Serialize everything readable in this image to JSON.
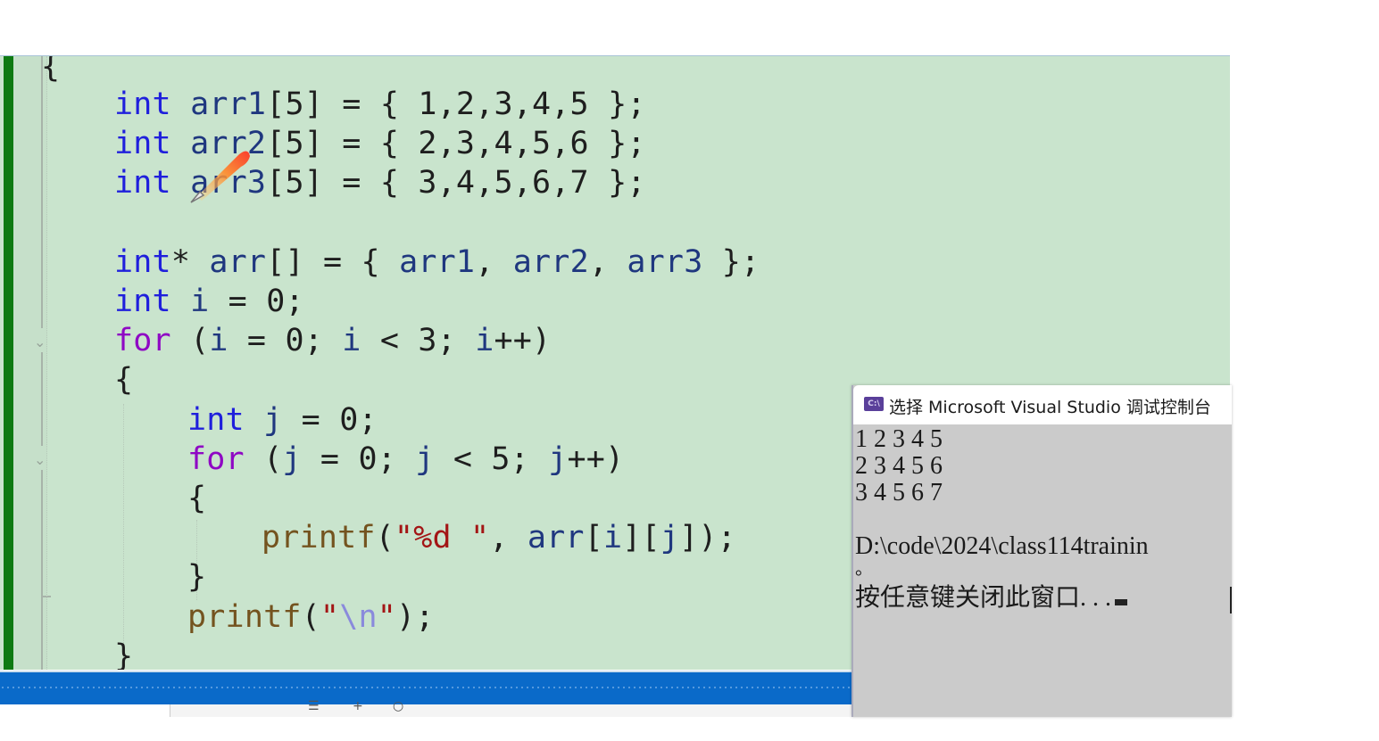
{
  "editor": {
    "background": "#c9e4cd",
    "lines": [
      {
        "text": "{"
      },
      {
        "parts": [
          [
            "kw",
            "int"
          ],
          [
            "",
            "  "
          ],
          [
            "var",
            "arr1"
          ],
          [
            "",
            "[5] = { 1,2,3,4,5 };"
          ]
        ]
      },
      {
        "parts": [
          [
            "kw",
            "int"
          ],
          [
            "",
            "  "
          ],
          [
            "var",
            "arr2"
          ],
          [
            "",
            "[5] = { 2,3,4,5,6 };"
          ]
        ]
      },
      {
        "parts": [
          [
            "kw",
            "int"
          ],
          [
            "",
            "  "
          ],
          [
            "var",
            "arr3"
          ],
          [
            "",
            "[5] = { 3,4,5,6,7 };"
          ]
        ]
      },
      {
        "parts": [
          [
            "kw",
            "int"
          ],
          [
            "",
            "* "
          ],
          [
            "var",
            "arr"
          ],
          [
            "",
            "[] = { "
          ],
          [
            "var",
            "arr1"
          ],
          [
            "",
            ", "
          ],
          [
            "var",
            "arr2"
          ],
          [
            "",
            ", "
          ],
          [
            "var",
            "arr3"
          ],
          [
            "",
            " };"
          ]
        ]
      },
      {
        "parts": [
          [
            "kw",
            "int"
          ],
          [
            "",
            " "
          ],
          [
            "var",
            "i"
          ],
          [
            "",
            " = 0;"
          ]
        ]
      },
      {
        "parts": [
          [
            "ctl",
            "for"
          ],
          [
            "",
            " ("
          ],
          [
            "var",
            "i"
          ],
          [
            "",
            " = 0; "
          ],
          [
            "var",
            "i"
          ],
          [
            "",
            " < 3; "
          ],
          [
            "var",
            "i"
          ],
          [
            "",
            "++)"
          ]
        ]
      },
      {
        "text": "{"
      },
      {
        "parts": [
          [
            "kw",
            "int"
          ],
          [
            "",
            " "
          ],
          [
            "var",
            "j"
          ],
          [
            "",
            " = 0;"
          ]
        ]
      },
      {
        "parts": [
          [
            "ctl",
            "for"
          ],
          [
            "",
            " ("
          ],
          [
            "var",
            "j"
          ],
          [
            "",
            " = 0; "
          ],
          [
            "var",
            "j"
          ],
          [
            "",
            " < 5; "
          ],
          [
            "var",
            "j"
          ],
          [
            "",
            "++)"
          ]
        ]
      },
      {
        "text": "{"
      },
      {
        "parts": [
          [
            "fn",
            "printf"
          ],
          [
            "",
            "("
          ],
          [
            "str",
            "\"%d \""
          ],
          [
            "",
            ", "
          ],
          [
            "var",
            "arr"
          ],
          [
            "",
            "["
          ],
          [
            "var",
            "i"
          ],
          [
            "",
            "]["
          ],
          [
            "var",
            "j"
          ],
          [
            "",
            "]);"
          ]
        ]
      },
      {
        "text": "}"
      },
      {
        "parts": [
          [
            "fn",
            "printf"
          ],
          [
            "",
            "("
          ],
          [
            "str",
            "\""
          ],
          [
            "esc",
            "\\n"
          ],
          [
            "str",
            "\""
          ],
          [
            "",
            ");"
          ]
        ]
      },
      {
        "text": "}"
      }
    ]
  },
  "console": {
    "icon": "console-app-icon",
    "icon_label": "C:\\",
    "title": "选择 Microsoft Visual Studio 调试控制台",
    "output_lines": [
      "1 2 3 4 5",
      "2 3 4 5 6",
      "3 4 5 6 7"
    ],
    "exit_path": "D:\\code\\2024\\class114trainin",
    "exit_tail": "。",
    "prompt": "按任意键关闭此窗口. . ."
  },
  "colors": {
    "keyword": "#1f1fdc",
    "control": "#8f08c4",
    "variable": "#1f377f",
    "function": "#74531f",
    "string": "#a31515",
    "change_bar": "#0e7a12",
    "status_bar": "#0a6ac9",
    "console_bg": "#cbcbcb"
  }
}
